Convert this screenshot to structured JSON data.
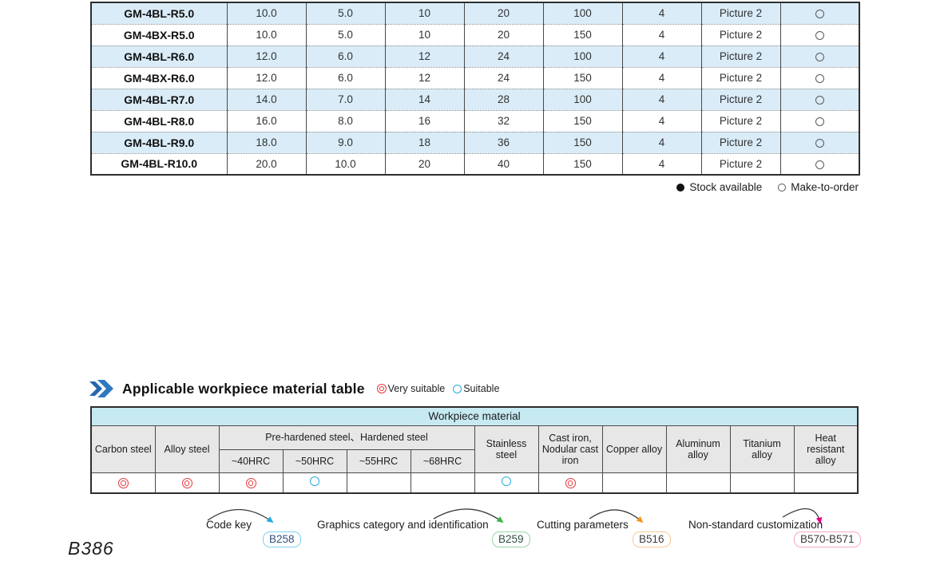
{
  "page": {
    "number": "B386"
  },
  "product_table": {
    "rows": [
      {
        "model": "GM-4BL-R5.0",
        "values": [
          "10.0",
          "5.0",
          "10",
          "20",
          "100",
          "4",
          "Picture 2"
        ],
        "availability": "Make-to-order"
      },
      {
        "model": "GM-4BX-R5.0",
        "values": [
          "10.0",
          "5.0",
          "10",
          "20",
          "150",
          "4",
          "Picture 2"
        ],
        "availability": "Make-to-order"
      },
      {
        "model": "GM-4BL-R6.0",
        "values": [
          "12.0",
          "6.0",
          "12",
          "24",
          "100",
          "4",
          "Picture 2"
        ],
        "availability": "Make-to-order"
      },
      {
        "model": "GM-4BX-R6.0",
        "values": [
          "12.0",
          "6.0",
          "12",
          "24",
          "150",
          "4",
          "Picture 2"
        ],
        "availability": "Make-to-order"
      },
      {
        "model": "GM-4BL-R7.0",
        "values": [
          "14.0",
          "7.0",
          "14",
          "28",
          "100",
          "4",
          "Picture 2"
        ],
        "availability": "Make-to-order"
      },
      {
        "model": "GM-4BL-R8.0",
        "values": [
          "16.0",
          "8.0",
          "16",
          "32",
          "150",
          "4",
          "Picture 2"
        ],
        "availability": "Make-to-order"
      },
      {
        "model": "GM-4BL-R9.0",
        "values": [
          "18.0",
          "9.0",
          "18",
          "36",
          "150",
          "4",
          "Picture 2"
        ],
        "availability": "Make-to-order"
      },
      {
        "model": "GM-4BL-R10.0",
        "values": [
          "20.0",
          "10.0",
          "20",
          "40",
          "150",
          "4",
          "Picture 2"
        ],
        "availability": "Make-to-order"
      }
    ],
    "legend": {
      "available": "Stock available",
      "make_to_order": "Make-to-order"
    }
  },
  "material_section": {
    "title": "Applicable workpiece material table",
    "legend": {
      "very_suitable": "Very suitable",
      "suitable": "Suitable"
    },
    "table": {
      "header": "Workpiece material",
      "col_carbon": "Carbon steel",
      "col_alloy": "Alloy steel",
      "group_hardened": "Pre-hardened steel、Hardened steel",
      "hrc": [
        "~40HRC",
        "~50HRC",
        "~55HRC",
        "~68HRC"
      ],
      "col_stainless": "Stainless steel",
      "col_cast_iron": "Cast iron, Nodular cast iron",
      "col_copper": "Copper alloy",
      "col_aluminum": "Aluminum alloy",
      "col_titanium": "Titanium alloy",
      "col_heat": "Heat resistant alloy",
      "ratings": [
        "very-suitable",
        "very-suitable",
        "very-suitable",
        "suitable",
        "",
        "",
        "suitable",
        "very-suitable",
        "",
        "",
        "",
        ""
      ]
    }
  },
  "footer": {
    "references": [
      {
        "label": "Code key",
        "badge": "B258",
        "accent": "#29abe2"
      },
      {
        "label": "Graphics category and identification",
        "badge": "B259",
        "accent": "#39b54a"
      },
      {
        "label": "Cutting parameters",
        "badge": "B516",
        "accent": "#f7941e"
      },
      {
        "label": "Non-standard customization",
        "badge": "B570-B571",
        "accent": "#ec008c"
      }
    ]
  },
  "colors": {
    "row_shade": "#d9ecf8",
    "caption_cyan": "#c6e9f2",
    "header_gray": "#e7e7e7",
    "very_suitable_red": "#e8383d",
    "suitable_cyan": "#29abe2"
  }
}
